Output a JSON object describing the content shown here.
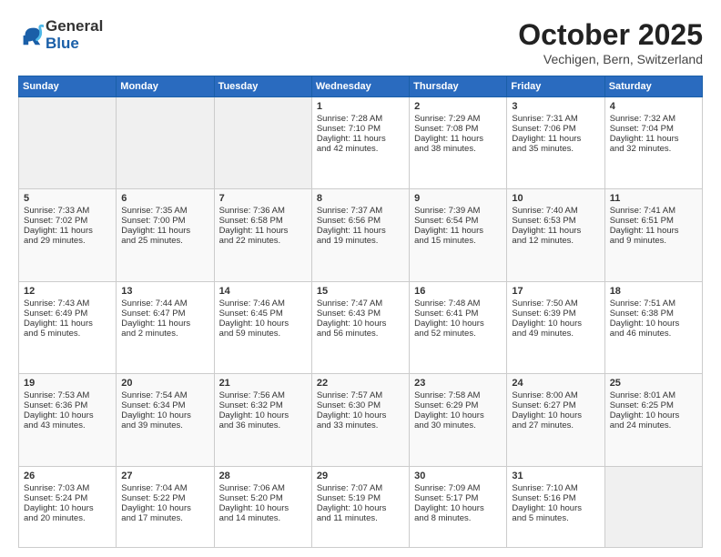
{
  "header": {
    "logo_line1": "General",
    "logo_line2": "Blue",
    "month": "October 2025",
    "location": "Vechigen, Bern, Switzerland"
  },
  "days_of_week": [
    "Sunday",
    "Monday",
    "Tuesday",
    "Wednesday",
    "Thursday",
    "Friday",
    "Saturday"
  ],
  "weeks": [
    [
      {
        "day": "",
        "info": ""
      },
      {
        "day": "",
        "info": ""
      },
      {
        "day": "",
        "info": ""
      },
      {
        "day": "1",
        "info": "Sunrise: 7:28 AM\nSunset: 7:10 PM\nDaylight: 11 hours\nand 42 minutes."
      },
      {
        "day": "2",
        "info": "Sunrise: 7:29 AM\nSunset: 7:08 PM\nDaylight: 11 hours\nand 38 minutes."
      },
      {
        "day": "3",
        "info": "Sunrise: 7:31 AM\nSunset: 7:06 PM\nDaylight: 11 hours\nand 35 minutes."
      },
      {
        "day": "4",
        "info": "Sunrise: 7:32 AM\nSunset: 7:04 PM\nDaylight: 11 hours\nand 32 minutes."
      }
    ],
    [
      {
        "day": "5",
        "info": "Sunrise: 7:33 AM\nSunset: 7:02 PM\nDaylight: 11 hours\nand 29 minutes."
      },
      {
        "day": "6",
        "info": "Sunrise: 7:35 AM\nSunset: 7:00 PM\nDaylight: 11 hours\nand 25 minutes."
      },
      {
        "day": "7",
        "info": "Sunrise: 7:36 AM\nSunset: 6:58 PM\nDaylight: 11 hours\nand 22 minutes."
      },
      {
        "day": "8",
        "info": "Sunrise: 7:37 AM\nSunset: 6:56 PM\nDaylight: 11 hours\nand 19 minutes."
      },
      {
        "day": "9",
        "info": "Sunrise: 7:39 AM\nSunset: 6:54 PM\nDaylight: 11 hours\nand 15 minutes."
      },
      {
        "day": "10",
        "info": "Sunrise: 7:40 AM\nSunset: 6:53 PM\nDaylight: 11 hours\nand 12 minutes."
      },
      {
        "day": "11",
        "info": "Sunrise: 7:41 AM\nSunset: 6:51 PM\nDaylight: 11 hours\nand 9 minutes."
      }
    ],
    [
      {
        "day": "12",
        "info": "Sunrise: 7:43 AM\nSunset: 6:49 PM\nDaylight: 11 hours\nand 5 minutes."
      },
      {
        "day": "13",
        "info": "Sunrise: 7:44 AM\nSunset: 6:47 PM\nDaylight: 11 hours\nand 2 minutes."
      },
      {
        "day": "14",
        "info": "Sunrise: 7:46 AM\nSunset: 6:45 PM\nDaylight: 10 hours\nand 59 minutes."
      },
      {
        "day": "15",
        "info": "Sunrise: 7:47 AM\nSunset: 6:43 PM\nDaylight: 10 hours\nand 56 minutes."
      },
      {
        "day": "16",
        "info": "Sunrise: 7:48 AM\nSunset: 6:41 PM\nDaylight: 10 hours\nand 52 minutes."
      },
      {
        "day": "17",
        "info": "Sunrise: 7:50 AM\nSunset: 6:39 PM\nDaylight: 10 hours\nand 49 minutes."
      },
      {
        "day": "18",
        "info": "Sunrise: 7:51 AM\nSunset: 6:38 PM\nDaylight: 10 hours\nand 46 minutes."
      }
    ],
    [
      {
        "day": "19",
        "info": "Sunrise: 7:53 AM\nSunset: 6:36 PM\nDaylight: 10 hours\nand 43 minutes."
      },
      {
        "day": "20",
        "info": "Sunrise: 7:54 AM\nSunset: 6:34 PM\nDaylight: 10 hours\nand 39 minutes."
      },
      {
        "day": "21",
        "info": "Sunrise: 7:56 AM\nSunset: 6:32 PM\nDaylight: 10 hours\nand 36 minutes."
      },
      {
        "day": "22",
        "info": "Sunrise: 7:57 AM\nSunset: 6:30 PM\nDaylight: 10 hours\nand 33 minutes."
      },
      {
        "day": "23",
        "info": "Sunrise: 7:58 AM\nSunset: 6:29 PM\nDaylight: 10 hours\nand 30 minutes."
      },
      {
        "day": "24",
        "info": "Sunrise: 8:00 AM\nSunset: 6:27 PM\nDaylight: 10 hours\nand 27 minutes."
      },
      {
        "day": "25",
        "info": "Sunrise: 8:01 AM\nSunset: 6:25 PM\nDaylight: 10 hours\nand 24 minutes."
      }
    ],
    [
      {
        "day": "26",
        "info": "Sunrise: 7:03 AM\nSunset: 5:24 PM\nDaylight: 10 hours\nand 20 minutes."
      },
      {
        "day": "27",
        "info": "Sunrise: 7:04 AM\nSunset: 5:22 PM\nDaylight: 10 hours\nand 17 minutes."
      },
      {
        "day": "28",
        "info": "Sunrise: 7:06 AM\nSunset: 5:20 PM\nDaylight: 10 hours\nand 14 minutes."
      },
      {
        "day": "29",
        "info": "Sunrise: 7:07 AM\nSunset: 5:19 PM\nDaylight: 10 hours\nand 11 minutes."
      },
      {
        "day": "30",
        "info": "Sunrise: 7:09 AM\nSunset: 5:17 PM\nDaylight: 10 hours\nand 8 minutes."
      },
      {
        "day": "31",
        "info": "Sunrise: 7:10 AM\nSunset: 5:16 PM\nDaylight: 10 hours\nand 5 minutes."
      },
      {
        "day": "",
        "info": ""
      }
    ]
  ]
}
